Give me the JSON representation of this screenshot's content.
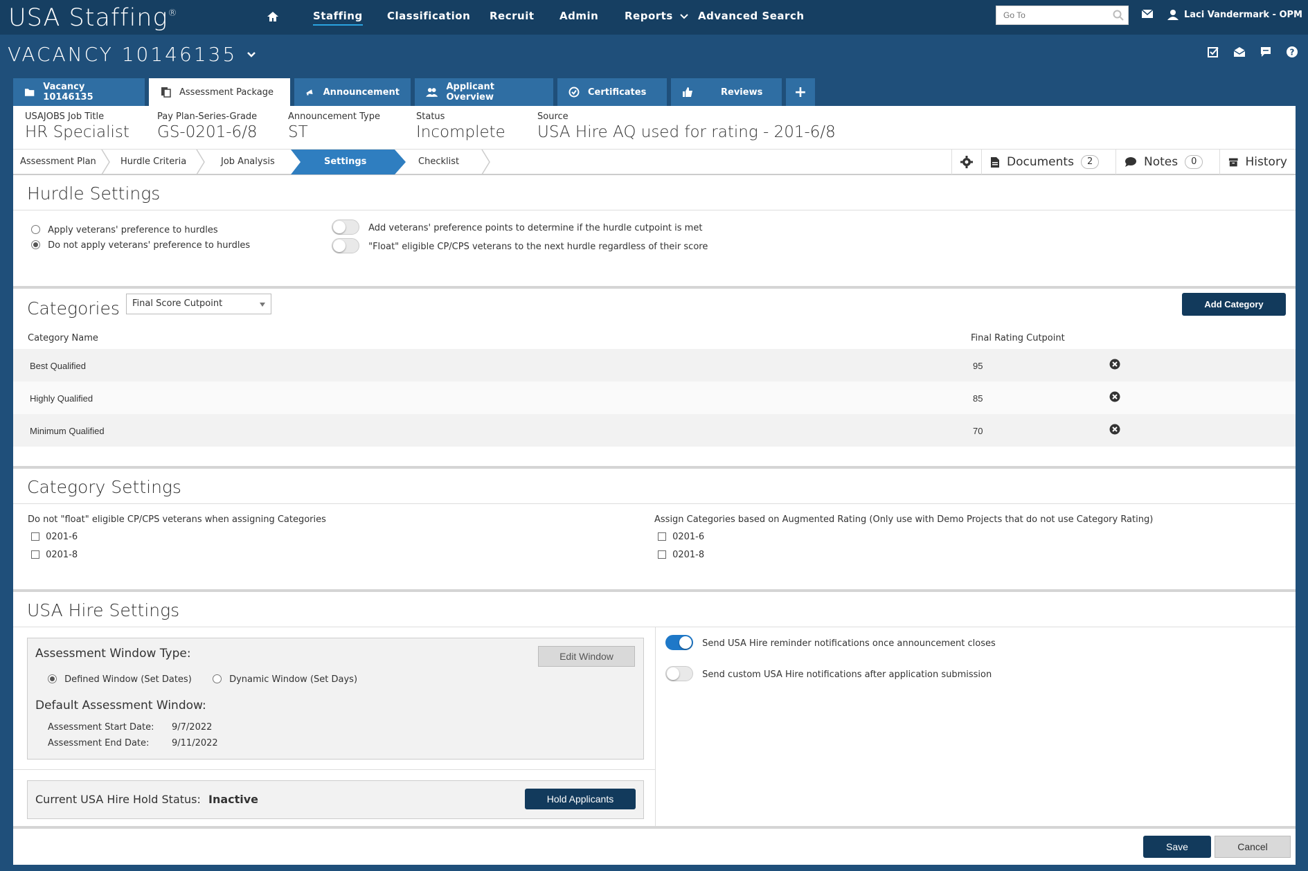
{
  "nav": {
    "brand": "USA Staffing",
    "brand_mark": "®",
    "items": [
      "Staffing",
      "Classification",
      "Recruit",
      "Admin",
      "Reports",
      "Advanced Search"
    ],
    "active": "Staffing",
    "goto_placeholder": "Go To",
    "user": "Laci Vandermark - OPM"
  },
  "vacancy": {
    "title": "VACANCY 10146135"
  },
  "tabs": [
    {
      "label": "Vacancy 10146135",
      "icon": "folder-icon"
    },
    {
      "label": "Assessment Package",
      "icon": "clipboard-icon"
    },
    {
      "label": "Announcement",
      "icon": "megaphone-icon"
    },
    {
      "label": "Applicant Overview",
      "icon": "users-icon"
    },
    {
      "label": "Certificates",
      "icon": "check-circle-icon"
    },
    {
      "label": "Reviews",
      "icon": "thumbs-up-icon"
    },
    {
      "label": "+",
      "icon": "plus-icon"
    }
  ],
  "info": {
    "job_title_label": "USAJOBS Job Title",
    "job_title": "HR Specialist",
    "ppsg_label": "Pay Plan-Series-Grade",
    "ppsg": "GS-0201-6/8",
    "ann_type_label": "Announcement Type",
    "ann_type": "ST",
    "status_label": "Status",
    "status": "Incomplete",
    "source_label": "Source",
    "source": "USA Hire AQ used for rating - 201-6/8"
  },
  "steps": [
    "Assessment Plan",
    "Hurdle Criteria",
    "Job Analysis",
    "Settings",
    "Checklist"
  ],
  "tools": {
    "documents_label": "Documents",
    "documents_count": "2",
    "notes_label": "Notes",
    "notes_count": "0",
    "history_label": "History"
  },
  "hurdle": {
    "title": "Hurdle Settings",
    "radio_apply": "Apply veterans' preference to hurdles",
    "radio_not_apply": "Do not apply veterans' preference to hurdles",
    "toggle_add_points": "Add veterans' preference points to determine if the hurdle cutpoint is met",
    "toggle_float": "\"Float\" eligible CP/CPS veterans to the next hurdle regardless of their score"
  },
  "categories": {
    "title": "Categories",
    "select_value": "Final Score Cutpoint",
    "add_button": "Add Category",
    "col_name": "Category Name",
    "col_cutpoint": "Final Rating Cutpoint",
    "rows": [
      {
        "name": "Best Qualified",
        "cutpoint": "95"
      },
      {
        "name": "Highly Qualified",
        "cutpoint": "85"
      },
      {
        "name": "Minimum Qualified",
        "cutpoint": "70"
      }
    ]
  },
  "category_settings": {
    "title": "Category Settings",
    "left_label": "Do not \"float\" eligible CP/CPS veterans when assigning Categories",
    "right_label": "Assign Categories based on Augmented Rating (Only use with Demo Projects that do not use Category Rating)",
    "grades": [
      "0201-6",
      "0201-8"
    ]
  },
  "usa_hire": {
    "title": "USA Hire Settings",
    "window_type_label": "Assessment Window Type:",
    "edit_window": "Edit Window",
    "defined_window": "Defined Window (Set Dates)",
    "dynamic_window": "Dynamic Window (Set Days)",
    "default_window_label": "Default Assessment Window:",
    "start_label": "Assessment Start Date:",
    "start_value": "9/7/2022",
    "end_label": "Assessment End Date:",
    "end_value": "9/11/2022",
    "hold_label": "Current USA Hire Hold Status:",
    "hold_value": "Inactive",
    "hold_button": "Hold Applicants",
    "reminder_toggle": "Send USA Hire reminder notifications once announcement closes",
    "custom_toggle": "Send custom USA Hire notifications after application submission"
  },
  "footer": {
    "save": "Save",
    "cancel": "Cancel"
  }
}
